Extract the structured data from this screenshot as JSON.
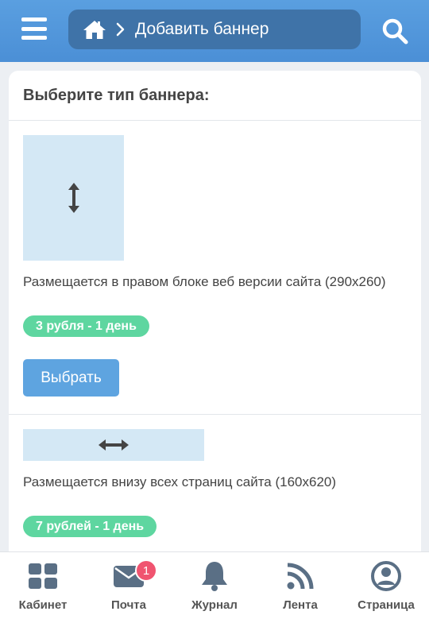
{
  "header": {
    "breadcrumb_current": "Добавить баннер",
    "icons": [
      "menu-icon",
      "home-icon",
      "chevron-right-icon",
      "search-icon"
    ]
  },
  "card": {
    "title": "Выберите тип баннера:",
    "options": [
      {
        "description": "Размещается в правом блоке веб версии сайта (290x260)",
        "price": "3 рубля - 1 день",
        "button": "Выбрать",
        "icon": "vertical-arrows-icon"
      },
      {
        "description": "Размещается внизу всех страниц сайта (160x620)",
        "price": "7 рублей - 1 день",
        "icon": "horizontal-arrows-icon"
      }
    ]
  },
  "bottom_nav": {
    "items": [
      {
        "label": "Кабинет",
        "icon": "grid-icon"
      },
      {
        "label": "Почта",
        "icon": "mail-icon",
        "badge": "1"
      },
      {
        "label": "Журнал",
        "icon": "bell-icon"
      },
      {
        "label": "Лента",
        "icon": "rss-icon"
      },
      {
        "label": "Страница",
        "icon": "user-icon"
      }
    ]
  },
  "colors": {
    "header": "#4b8fd6",
    "breadcrumb_bg": "#3f73a8",
    "price_badge": "#5ed6a0",
    "button": "#5ea4e0",
    "notification": "#f05470",
    "nav_icon": "#5a6f85"
  }
}
